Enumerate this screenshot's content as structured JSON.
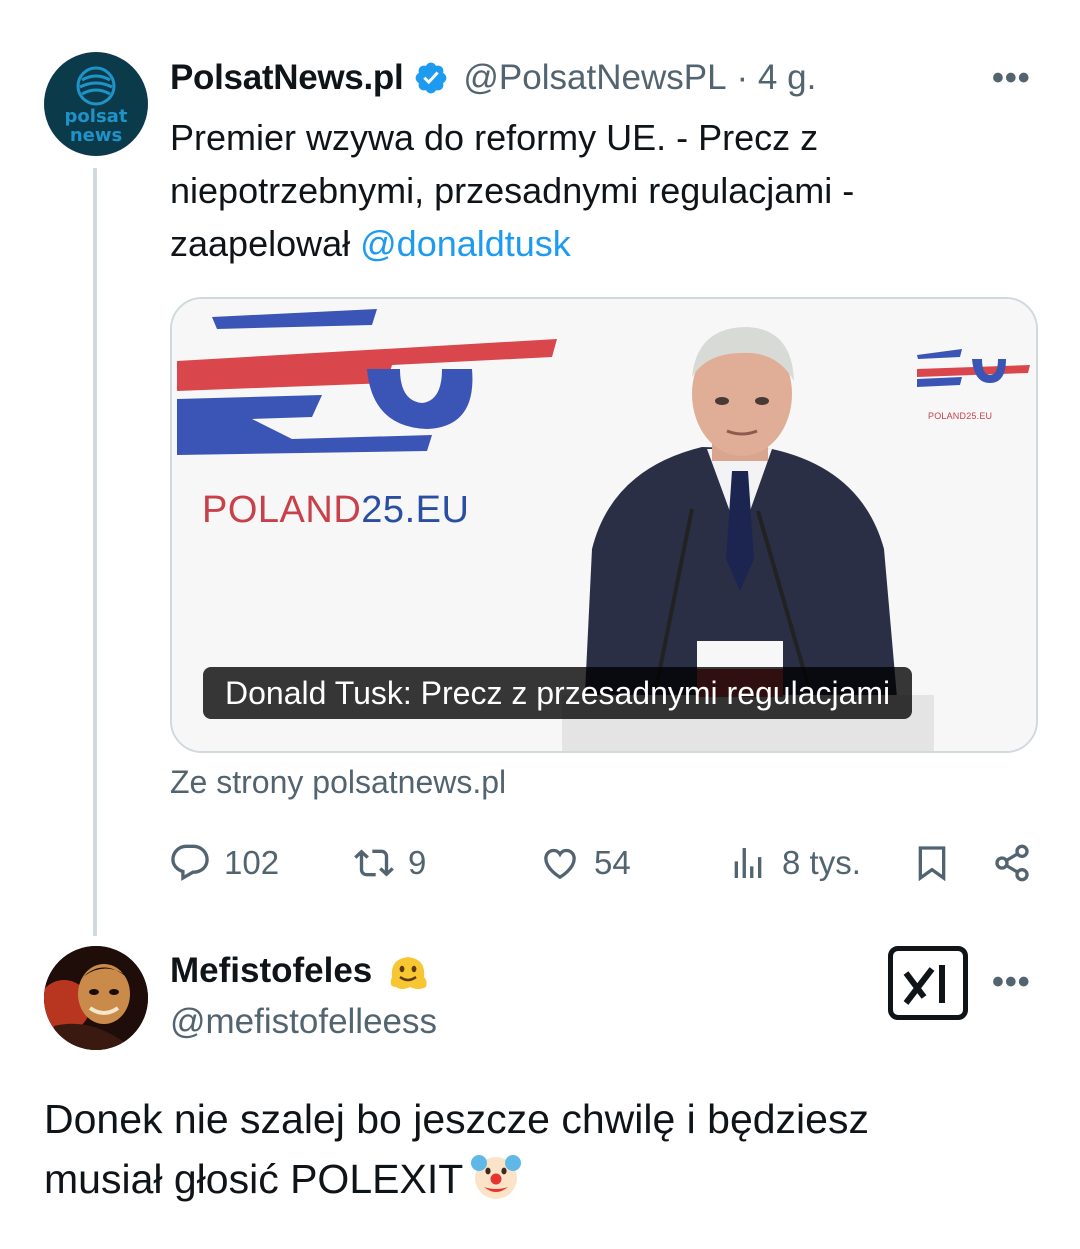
{
  "tweet": {
    "author_name": "PolsatNews.pl",
    "author_handle": "@PolsatNewsPL",
    "time": "· 4 g.",
    "avatar_text_line1": "polsat",
    "avatar_text_line2": "news",
    "text_lines": [
      "Premier wzywa do reformy UE. - Precz z",
      "niepotrzebnymi, przesadnymi regulacjami -",
      "zaapelował "
    ],
    "mention": "@donaldtusk",
    "card": {
      "title": "Donald Tusk: Precz z przesadnymi regulacjami",
      "backdrop_text_main": "POLAND",
      "backdrop_text_num": "25",
      "backdrop_text_tld": ".EU",
      "backdrop_mini": "POLAND25.EU"
    },
    "source": "Ze strony polsatnews.pl",
    "actions": {
      "replies": "102",
      "reposts": "9",
      "likes": "54",
      "views": "8 tys."
    },
    "more_label": "•••"
  },
  "reply": {
    "author_name": "Mefistofeles",
    "author_handle": "@mefistofelleess",
    "text_line1": "Donek nie szalej bo jeszcze chwilę i będziesz",
    "text_line2": "musiał głosić POLEXIT",
    "more_label": "•••"
  },
  "colors": {
    "accent": "#1d9bf0",
    "muted": "#536471",
    "text": "#0f1419",
    "border": "#cfd9de"
  }
}
